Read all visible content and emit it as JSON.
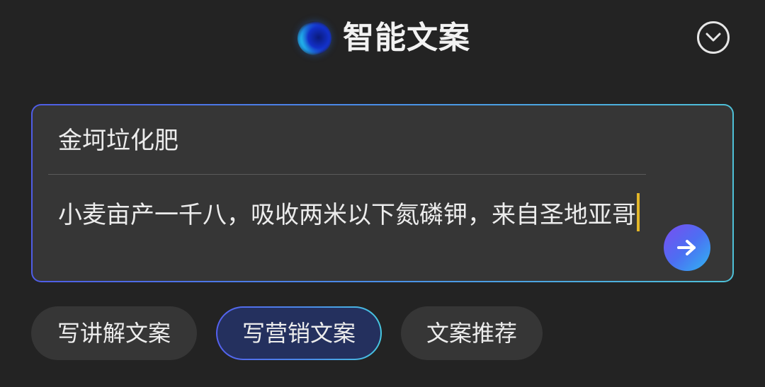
{
  "header": {
    "title": "智能文案",
    "logo_icon": "gradient-orb-logo-icon",
    "collapse_icon": "chevron-down-circle-icon"
  },
  "input_card": {
    "topic": "金坷垃化肥",
    "content": "小麦亩产一千八，吸收两米以下氮磷钾，来自圣地亚哥",
    "send_icon": "arrow-right-icon"
  },
  "chips": [
    {
      "label": "写讲解文案",
      "selected": false
    },
    {
      "label": "写营销文案",
      "selected": true
    },
    {
      "label": "文案推荐",
      "selected": false
    }
  ],
  "colors": {
    "background": "#232323",
    "card": "#363636",
    "accent_start": "#5460ee",
    "accent_end": "#46c7e0",
    "caret": "#e2b628"
  }
}
